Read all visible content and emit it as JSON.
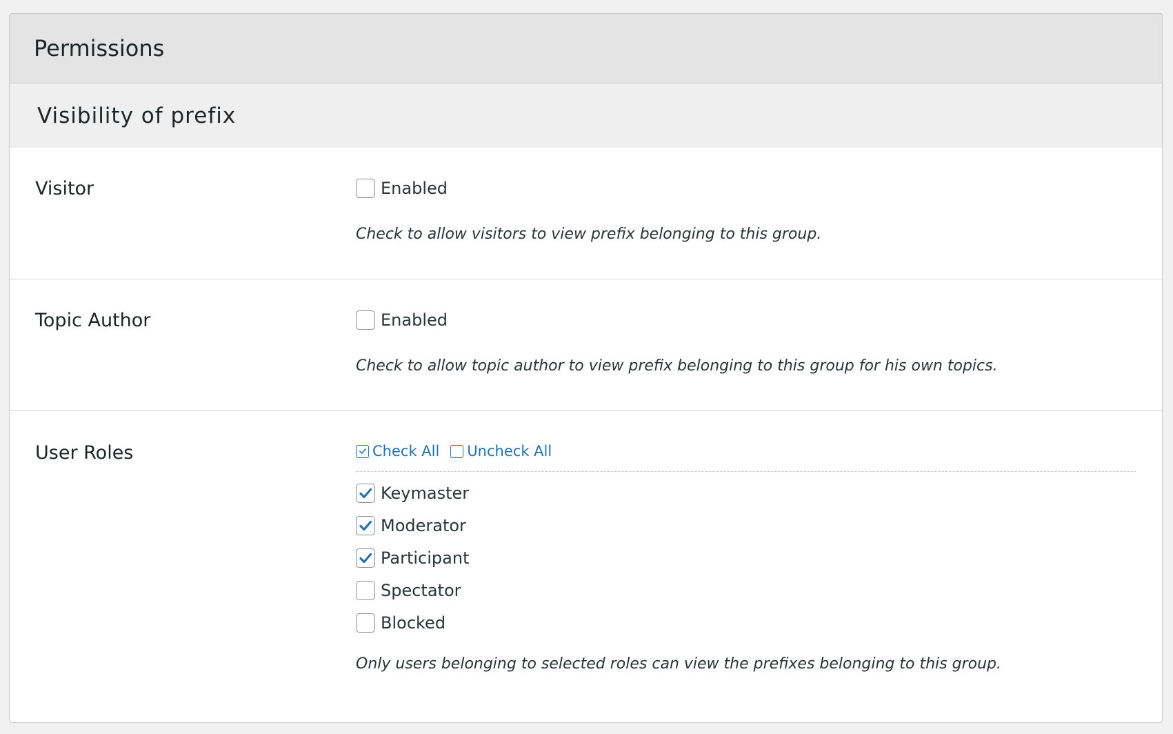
{
  "panel": {
    "title": "Permissions"
  },
  "section": {
    "title": "Visibility of prefix"
  },
  "visitor": {
    "label": "Visitor",
    "checkbox_label": "Enabled",
    "checked": false,
    "description": "Check to allow visitors to view prefix belonging to this group."
  },
  "topic_author": {
    "label": "Topic Author",
    "checkbox_label": "Enabled",
    "checked": false,
    "description": "Check to allow topic author to view prefix belonging to this group for his own topics."
  },
  "user_roles": {
    "label": "User Roles",
    "check_all": "Check All",
    "uncheck_all": "Uncheck All",
    "roles": [
      {
        "label": "Keymaster",
        "checked": true
      },
      {
        "label": "Moderator",
        "checked": true
      },
      {
        "label": "Participant",
        "checked": true
      },
      {
        "label": "Spectator",
        "checked": false
      },
      {
        "label": "Blocked",
        "checked": false
      }
    ],
    "description": "Only users belonging to selected roles can view the prefixes belonging to this group."
  },
  "colors": {
    "accent": "#2271b1",
    "checkmark": "#2271b1",
    "panel_header_bg": "#e4e4e4",
    "section_header_bg": "#efefef"
  }
}
